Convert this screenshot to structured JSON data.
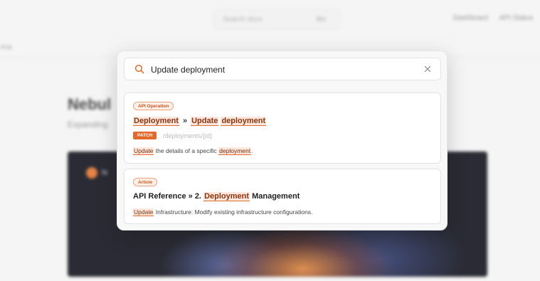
{
  "background": {
    "search_placeholder": "Search docs",
    "search_shortcut": "⌘K",
    "nav": [
      "Dashboard",
      "API Status"
    ],
    "left_text": "nna",
    "page_title": "Nebul",
    "page_subtitle": "Expanding",
    "hero_text": "N"
  },
  "search": {
    "value": "Update deployment",
    "icon": "search-icon",
    "clear_icon": "close-icon"
  },
  "results": [
    {
      "tag": "API Operation",
      "title_parts": [
        "Deployment",
        "»",
        "Update",
        "deployment"
      ],
      "method": "PATCH",
      "path": "/deployments/{id}",
      "desc_parts": [
        "Update",
        " the details of a specific ",
        "deployment",
        "."
      ]
    },
    {
      "tag": "Article",
      "title_parts": [
        "API Reference » 2. ",
        "Deployment",
        " Management"
      ],
      "desc_parts": [
        "Update",
        " Infrastructure: Modify existing infrastructure configurations."
      ]
    }
  ],
  "colors": {
    "accent": "#e2692b",
    "highlight_bg": "#fde7dc"
  }
}
